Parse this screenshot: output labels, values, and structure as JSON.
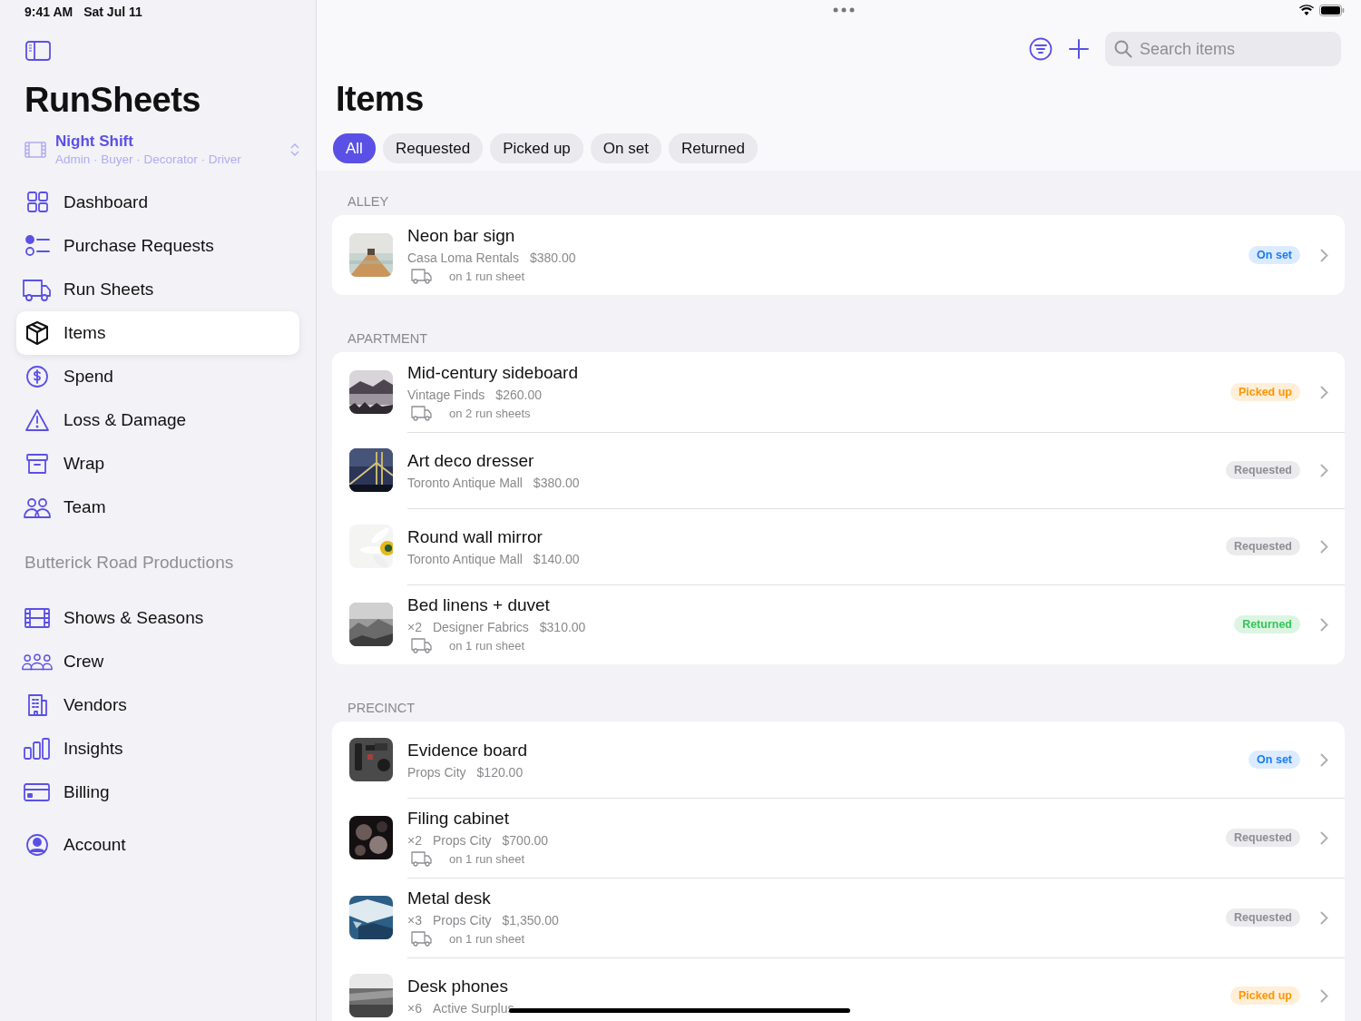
{
  "status_bar": {
    "time": "9:41 AM",
    "date": "Sat Jul 11"
  },
  "sidebar": {
    "app_title": "RunSheets",
    "show": {
      "name": "Night Shift",
      "roles": "Admin · Buyer · Decorator · Driver"
    },
    "items": [
      {
        "label": "Dashboard",
        "selected": false
      },
      {
        "label": "Purchase Requests",
        "selected": false
      },
      {
        "label": "Run Sheets",
        "selected": false
      },
      {
        "label": "Items",
        "selected": true
      },
      {
        "label": "Spend",
        "selected": false
      },
      {
        "label": "Loss & Damage",
        "selected": false
      },
      {
        "label": "Wrap",
        "selected": false
      },
      {
        "label": "Team",
        "selected": false
      }
    ],
    "section_title": "Butterick Road Productions",
    "org_items": [
      {
        "label": "Shows & Seasons",
        "selected": false
      },
      {
        "label": "Crew",
        "selected": false
      },
      {
        "label": "Vendors",
        "selected": false
      },
      {
        "label": "Insights",
        "selected": false
      },
      {
        "label": "Billing",
        "selected": false
      }
    ],
    "account": {
      "label": "Account",
      "selected": false
    }
  },
  "toolbar": {
    "search": {
      "placeholder": "Search items"
    }
  },
  "title": "Items",
  "filters": [
    {
      "label": "All",
      "selected": true
    },
    {
      "label": "Requested",
      "selected": false
    },
    {
      "label": "Picked up",
      "selected": false
    },
    {
      "label": "On set",
      "selected": false
    },
    {
      "label": "Returned",
      "selected": false
    }
  ],
  "groups": [
    {
      "title": "ALLEY",
      "items": [
        {
          "name": "Neon bar sign",
          "vendor": "Casa Loma Rentals",
          "price": "$380.00",
          "run_sheets": "on 1 run sheet",
          "status": "On set",
          "kind": "on_set"
        }
      ]
    },
    {
      "title": "APARTMENT",
      "items": [
        {
          "name": "Mid-century sideboard",
          "vendor": "Vintage Finds",
          "price": "$260.00",
          "run_sheets": "on 2 run sheets",
          "status": "Picked up",
          "kind": "picked_up"
        },
        {
          "name": "Art deco dresser",
          "vendor": "Toronto Antique Mall",
          "price": "$380.00",
          "status": "Requested",
          "kind": "requested"
        },
        {
          "name": "Round wall mirror",
          "vendor": "Toronto Antique Mall",
          "price": "$140.00",
          "status": "Requested",
          "kind": "requested"
        },
        {
          "name": "Bed linens + duvet",
          "quantity": "×2",
          "vendor": "Designer Fabrics",
          "price": "$310.00",
          "run_sheets": "on 1 run sheet",
          "status": "Returned",
          "kind": "returned"
        }
      ]
    },
    {
      "title": "PRECINCT",
      "items": [
        {
          "name": "Evidence board",
          "vendor": "Props City",
          "price": "$120.00",
          "status": "On set",
          "kind": "on_set"
        },
        {
          "name": "Filing cabinet",
          "quantity": "×2",
          "vendor": "Props City",
          "price": "$700.00",
          "run_sheets": "on 1 run sheet",
          "status": "Requested",
          "kind": "requested"
        },
        {
          "name": "Metal desk",
          "quantity": "×3",
          "vendor": "Props City",
          "price": "$1,350.00",
          "run_sheets": "on 1 run sheet",
          "status": "Requested",
          "kind": "requested"
        },
        {
          "name": "Desk phones",
          "quantity": "×6",
          "vendor": "Active Surplus",
          "status": "Picked up",
          "kind": "picked_up"
        }
      ]
    }
  ]
}
